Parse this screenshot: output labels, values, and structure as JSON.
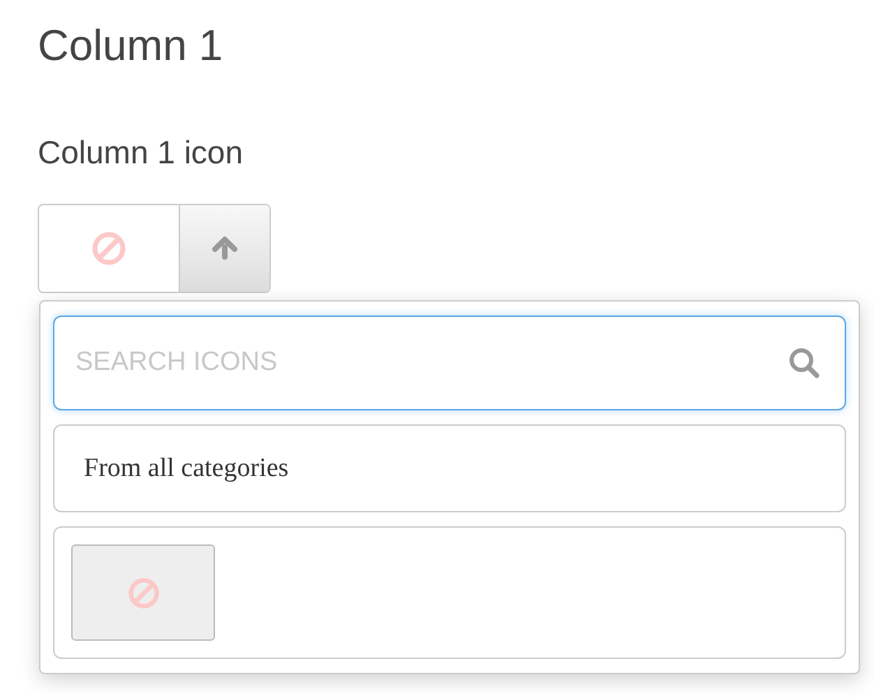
{
  "title": "Column 1",
  "icon_field": {
    "label": "Column 1 icon"
  },
  "popup": {
    "search": {
      "placeholder": "SEARCH ICONS"
    },
    "category_select": {
      "value": "From all categories"
    }
  }
}
